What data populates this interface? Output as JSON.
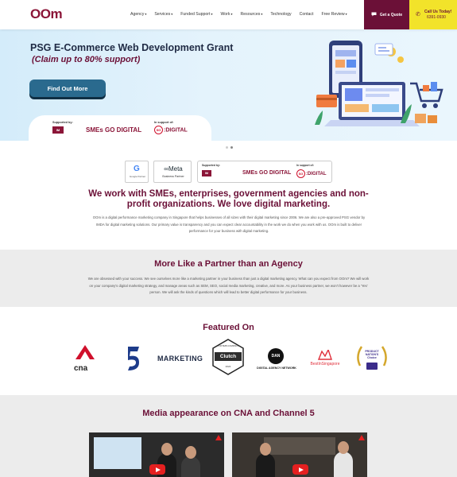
{
  "header": {
    "logo": "OOm",
    "nav": [
      {
        "label": "Agency",
        "dropdown": true
      },
      {
        "label": "Services",
        "dropdown": true
      },
      {
        "label": "Funded Support",
        "dropdown": true
      },
      {
        "label": "Work",
        "dropdown": true
      },
      {
        "label": "Resources",
        "dropdown": true
      },
      {
        "label": "Technology",
        "dropdown": false
      },
      {
        "label": "Contact",
        "dropdown": false
      },
      {
        "label": "Free Review",
        "dropdown": true
      }
    ],
    "quote_label": "Get a Quote",
    "call_label": "Call Us Today!",
    "call_number": "6391-0930",
    "colors": {
      "brand": "#6b1037",
      "call_bg": "#f2e32a"
    }
  },
  "hero": {
    "title": "PSG E-Commerce Web Development Grant",
    "subtitle": "(Claim up to 80% support)",
    "cta": "Find Out More",
    "supported_by": "Supported by:",
    "in_support_of": "In support of:",
    "imda": "IM",
    "smes": "SMEs GO DIGITAL",
    "sg": "SG",
    "digital": ":DIGITAL"
  },
  "badges": {
    "google_partner": "Google Partner",
    "meta_logo": "∞Meta",
    "meta_sub": "Business Partner",
    "supported_by": "Supported by:",
    "in_support_of": "In support of:",
    "imda": "IM",
    "smes": "SMEs GO DIGITAL",
    "sg": "SG",
    "digital": ":DIGITAL"
  },
  "intro": {
    "title": "We work with SMEs, enterprises, government agencies and non-profit organizations. We love digital marketing.",
    "text": "OOm is a digital performance marketing company in Singapore that helps businesses of all sizes with their digital marketing since 2006. We are also a pre-approved PSG vendor by IMDA for digital marketing solutions. Our primary value is transparency and you can expect clear accountability in the work we do when you work with us. OOm is built to deliver performance for your business with digital marketing."
  },
  "partner": {
    "title": "More Like a Partner than an Agency",
    "text": "We are obsessed with your success. We see ourselves more like a marketing partner in your business than just a digital marketing agency. What can you expect from OOm? We will work on your company's digital marketing strategy, and manage areas such as SEM, SEO, social media marketing, creative, and more. As your business partner, we won't however be a 'Yes' person. We will ask the kinds of questions which will lead to better digital performance for your business."
  },
  "featured": {
    "title": "Featured On",
    "logos": {
      "cna": "cna",
      "marketing": "MARKETING",
      "clutch": "Clutch",
      "clutch_top": "TOP B2B COMPANY",
      "clutch_year": "2024",
      "dan": "DAN",
      "dan_sub": "DIGITAL AGENCY NETWORK",
      "best_in": "BestInSingapore",
      "pnc": "PRODUCT NATION'S Choice"
    }
  },
  "media": {
    "title": "Media appearance on CNA and Channel 5"
  }
}
